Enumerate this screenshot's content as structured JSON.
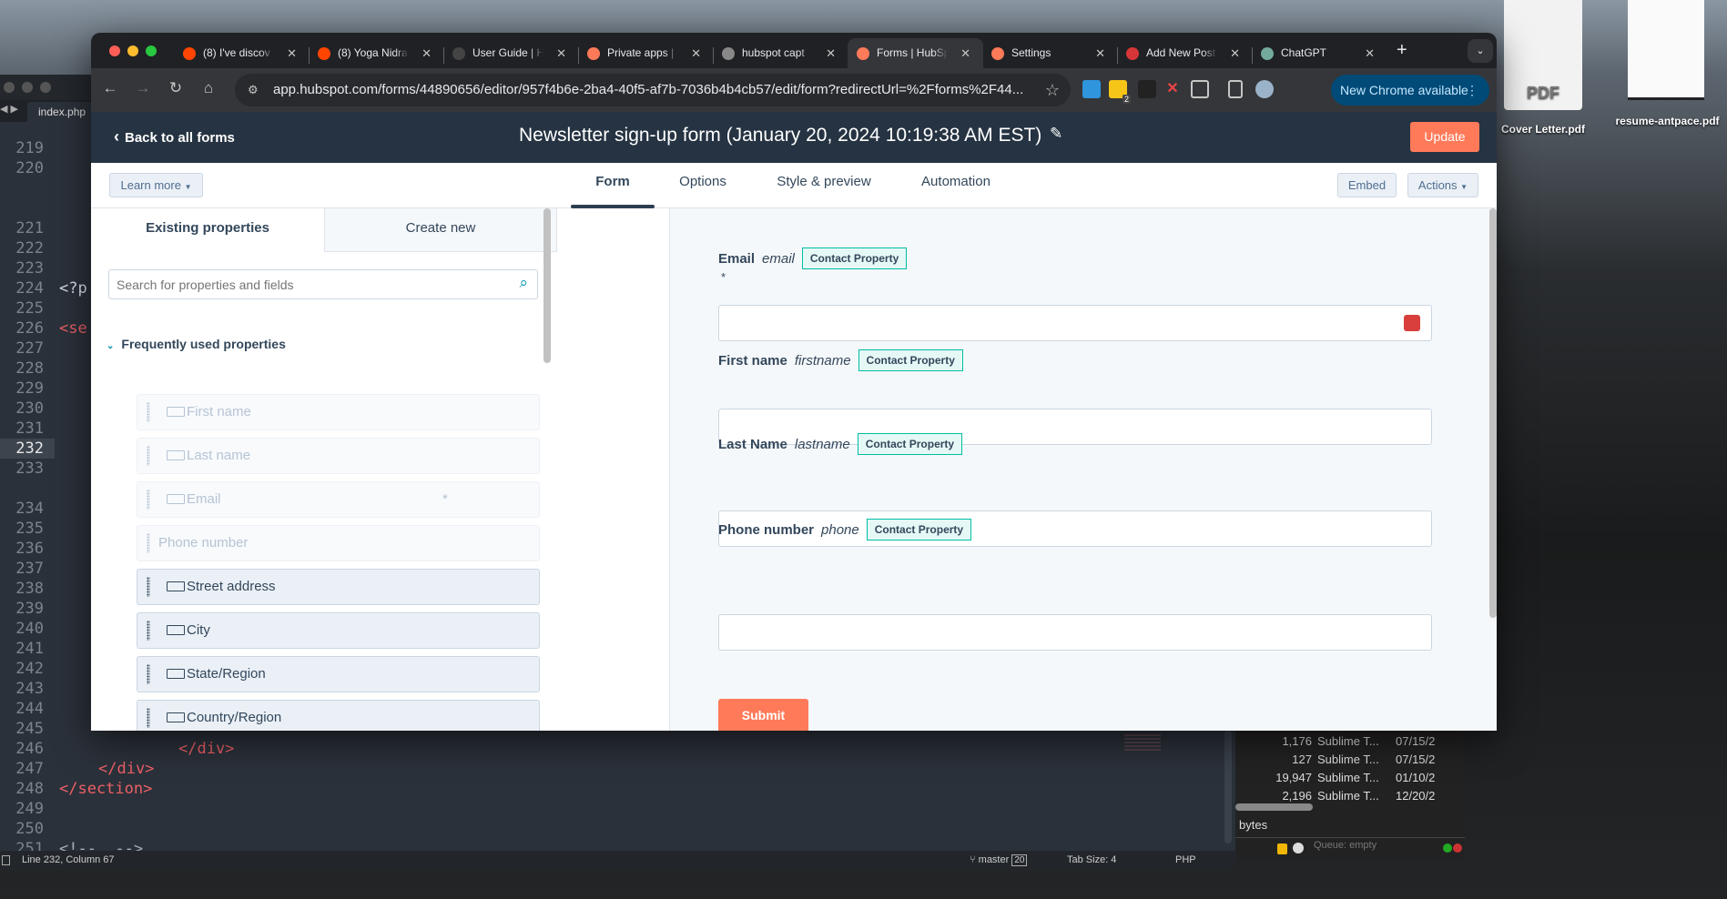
{
  "desktop": {
    "files": [
      {
        "name": "Cover Letter.pdf",
        "thumb": "PDF"
      },
      {
        "name": "resume-antpace.pdf"
      }
    ]
  },
  "sublime": {
    "tab": "index.php",
    "lines": [
      {
        "n": "219"
      },
      {
        "n": "220"
      },
      {
        "n": "221"
      },
      {
        "n": "222"
      },
      {
        "n": "223"
      },
      {
        "n": "224",
        "code": "<?p"
      },
      {
        "n": "225"
      },
      {
        "n": "226",
        "code": "<se"
      },
      {
        "n": "227"
      },
      {
        "n": "228"
      },
      {
        "n": "229"
      },
      {
        "n": "230"
      },
      {
        "n": "231"
      },
      {
        "n": "232",
        "current": true
      },
      {
        "n": "233"
      },
      {
        "n": "234"
      },
      {
        "n": "235"
      },
      {
        "n": "236"
      },
      {
        "n": "237"
      },
      {
        "n": "238"
      },
      {
        "n": "239"
      },
      {
        "n": "240"
      },
      {
        "n": "241"
      },
      {
        "n": "242"
      },
      {
        "n": "243"
      },
      {
        "n": "244"
      },
      {
        "n": "245"
      },
      {
        "n": "246",
        "code": "</div>"
      },
      {
        "n": "247",
        "code": "</div>"
      },
      {
        "n": "248",
        "code": "</section>"
      },
      {
        "n": "249"
      },
      {
        "n": "250"
      },
      {
        "n": "251",
        "code": "<!--  -->"
      }
    ],
    "status": {
      "position": "Line 232, Column 67",
      "branch": "master",
      "branch_count": "20",
      "tab_size": "Tab Size: 4",
      "syntax": "PHP"
    }
  },
  "ftp": {
    "rows": [
      {
        "size": "1,176",
        "kind": "Sublime T...",
        "date": "07/15/2"
      },
      {
        "size": "127",
        "kind": "Sublime T...",
        "date": "07/15/2"
      },
      {
        "size": "19,947",
        "kind": "Sublime T...",
        "date": "01/10/2"
      },
      {
        "size": "2,196",
        "kind": "Sublime T...",
        "date": "12/20/2"
      }
    ],
    "footer": "bytes",
    "queue": "Queue: empty"
  },
  "browser": {
    "tabs": [
      {
        "title": "(8) I've discov",
        "icon": "reddit-icon",
        "color": "#ff4500"
      },
      {
        "title": "(8) Yoga Nidra",
        "icon": "reddit-icon",
        "color": "#ff4500"
      },
      {
        "title": "User Guide | H",
        "icon": "hubspot-icon",
        "color": "#444"
      },
      {
        "title": "Private apps |",
        "icon": "hubspot-icon",
        "color": "#ff7a59"
      },
      {
        "title": "hubspot capt",
        "icon": "google-icon",
        "color": "#888"
      },
      {
        "title": "Forms | HubSpot",
        "icon": "hubspot-icon",
        "color": "#ff7a59",
        "active": true
      },
      {
        "title": "Settings",
        "icon": "hubspot-icon",
        "color": "#ff7a59"
      },
      {
        "title": "Add New Post",
        "icon": "wordpress-icon",
        "color": "#d63638"
      },
      {
        "title": "ChatGPT",
        "icon": "chatgpt-icon",
        "color": "#74aa9c"
      }
    ],
    "url": "app.hubspot.com/forms/44890656/editor/957f4b6e-2ba4-40f5-af7b-7036b4b4cb57/edit/form?redirectUrl=%2Fforms%2F44...",
    "extension_badge": "2",
    "new_chrome": "New Chrome available"
  },
  "hubspot": {
    "back": "Back to all forms",
    "title": "Newsletter sign-up form (January 20, 2024 10:19:38 AM EST)",
    "update": "Update",
    "learn_more": "Learn more",
    "nav_tabs": [
      {
        "label": "Form",
        "active": true
      },
      {
        "label": "Options"
      },
      {
        "label": "Style & preview"
      },
      {
        "label": "Automation"
      }
    ],
    "embed": "Embed",
    "actions": "Actions",
    "left": {
      "tabs": [
        {
          "label": "Existing properties",
          "active": true
        },
        {
          "label": "Create new"
        }
      ],
      "search_placeholder": "Search for properties and fields",
      "section": "Frequently used properties",
      "items": [
        {
          "label": "First name",
          "disabled": true
        },
        {
          "label": "Last name",
          "disabled": true
        },
        {
          "label": "Email",
          "disabled": true,
          "required": "*"
        },
        {
          "label": "Phone number",
          "disabled": true,
          "no_icon": true
        },
        {
          "label": "Street address"
        },
        {
          "label": "City"
        },
        {
          "label": "State/Region"
        },
        {
          "label": "Country/Region"
        }
      ]
    },
    "form": {
      "fields": [
        {
          "label": "Email",
          "internal": "email",
          "badge": "Contact Property",
          "required": "*"
        },
        {
          "label": "First name",
          "internal": "firstname",
          "badge": "Contact Property"
        },
        {
          "label": "Last Name",
          "internal": "lastname",
          "badge": "Contact Property"
        },
        {
          "label": "Phone number",
          "internal": "phone",
          "badge": "Contact Property"
        }
      ],
      "submit": "Submit"
    },
    "colors": {
      "header": "#253342",
      "accent": "#ff7a59",
      "badge_border": "#00bda5"
    }
  }
}
